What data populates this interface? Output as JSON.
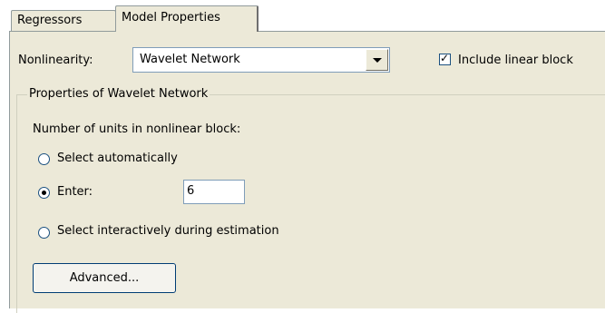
{
  "tabs": [
    {
      "label": "Regressors"
    },
    {
      "label": "Model Properties",
      "selected": true
    }
  ],
  "nonlinearity": {
    "label": "Nonlinearity:",
    "selected": "Wavelet Network",
    "dropdown_icon": "chevron-down-icon"
  },
  "include_linear_block": {
    "label": "Include linear block",
    "checked": true
  },
  "properties_group": {
    "title": "Properties of Wavelet Network",
    "units_label": "Number of units in nonlinear block:",
    "options": [
      {
        "label": "Select automatically",
        "selected": false
      },
      {
        "label": "Enter:",
        "selected": true
      },
      {
        "label": "Select interactively during estimation",
        "selected": false
      }
    ],
    "enter_value": "6",
    "advanced_button": "Advanced..."
  }
}
